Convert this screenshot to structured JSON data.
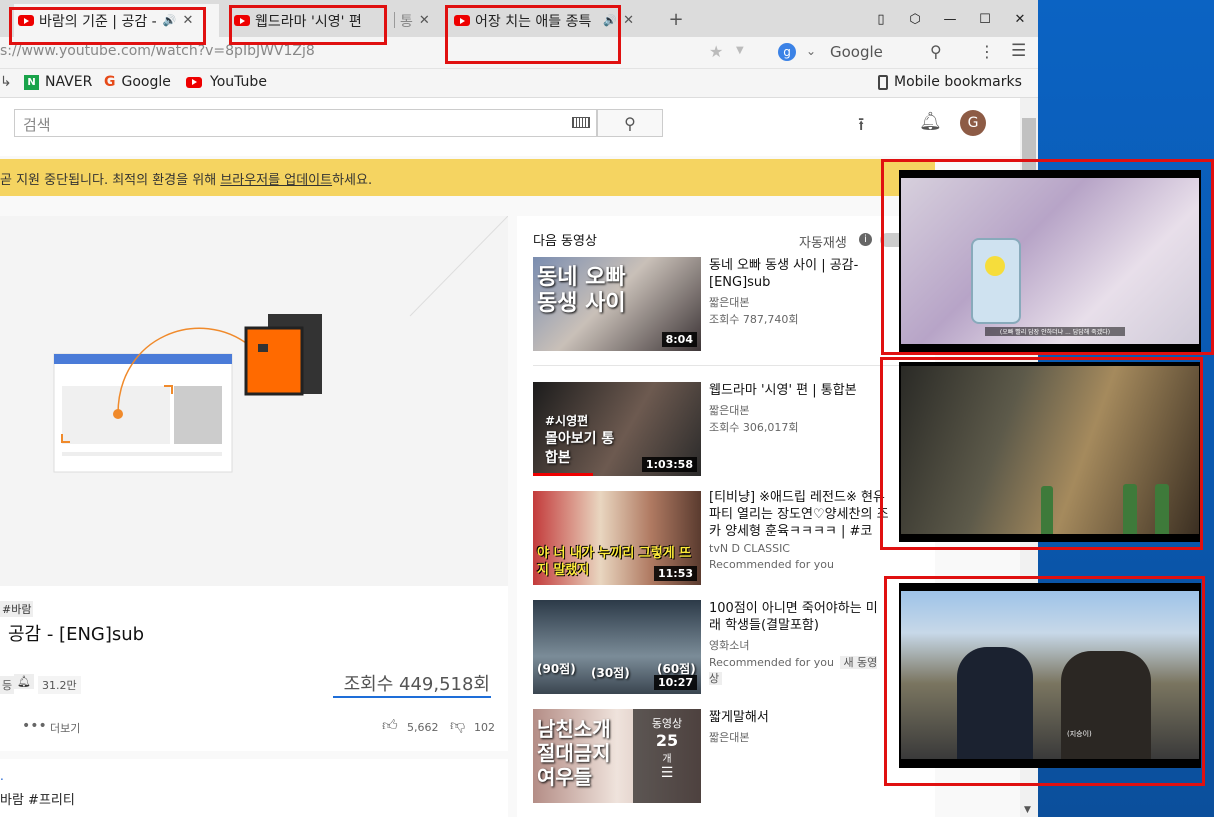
{
  "tabs": [
    {
      "title": "바람의 기준 | 공감 -",
      "audio": true
    },
    {
      "title": "웹드라마 '시영' 편"
    },
    {
      "title": "통"
    },
    {
      "title": "어장 치는 애들 종특"
    }
  ],
  "new_tab": "+",
  "address": {
    "url": "s://www.youtube.com/watch?v=8pIbJWV1Zj8",
    "search_engine": "Google",
    "menu_icon": "☰"
  },
  "bookmarks": [
    {
      "label": "NAVER",
      "icon": "naver-icon"
    },
    {
      "label": "Google",
      "icon": "google-icon"
    },
    {
      "label": "YouTube",
      "icon": "youtube-icon"
    }
  ],
  "mobile_bookmarks": "Mobile bookmarks",
  "youtube": {
    "search_placeholder": "검색",
    "avatar_letter": "G",
    "banner_prefix": "곧 지원 중단됩니다. 최적의 환경을 위해 ",
    "banner_link": "브라우저를 업데이트",
    "banner_suffix": "하세요.",
    "hashtag": "#바람",
    "video_title": "공감 - [ENG]sub",
    "sub_prefix": "등",
    "sub_count": "31.2만",
    "views": "조회수 449,518회",
    "more_label": "더보기",
    "likes": "5,662",
    "dislikes": "102",
    "desc_dot": ".",
    "desc_tags": "바람 #프리티",
    "up_next": "다음 동영상",
    "autoplay": "자동재생"
  },
  "recommendations": [
    {
      "title": "동네 오빠 동생 사이 | 공감-[ENG]sub",
      "channel": "짧은대본",
      "meta": "조회수 787,740회",
      "duration": "8:04",
      "thumb_text": "동네 오빠동생 사이"
    },
    {
      "title": "웹드라마 '시영' 편 | 통합본",
      "channel": "짧은대본",
      "meta": "조회수 306,017회",
      "duration": "1:03:58",
      "thumb_tag": "#시영편",
      "thumb_text": "몰아보기 통합본"
    },
    {
      "title": "[티비냥] ※애드립 레전드※ 현유 파티 열리는 장도연♡양세찬의 조카 양세형 훈육ㅋㅋㅋㅋ | #코",
      "channel": "tvN D CLASSIC",
      "meta": "Recommended for you",
      "duration": "11:53",
      "thumb_text": "야 너 내가 누끼리 그렇게 뜨지 말랬지"
    },
    {
      "title": "100점이 아니면 죽어야하는 미래 학생들(결말포함)",
      "channel": "영화소녀",
      "meta": "Recommended for you",
      "badge": "새 동영상",
      "duration": "10:27",
      "thumb_labels": [
        "(90점)",
        "(30점)",
        "(60점)"
      ]
    },
    {
      "title": "짧게말해서",
      "channel": "짧은대본",
      "playlist_label": "동영상",
      "playlist_count": "25",
      "playlist_unit": "개",
      "thumb_text": "남친소개 절대금지 여우들"
    }
  ],
  "pip_windows": [
    {
      "caption": "(오빠 빨리 답장 안하더냐 ... 답답해 죽겠다)"
    },
    {},
    {
      "caption": "(지승이)"
    }
  ]
}
